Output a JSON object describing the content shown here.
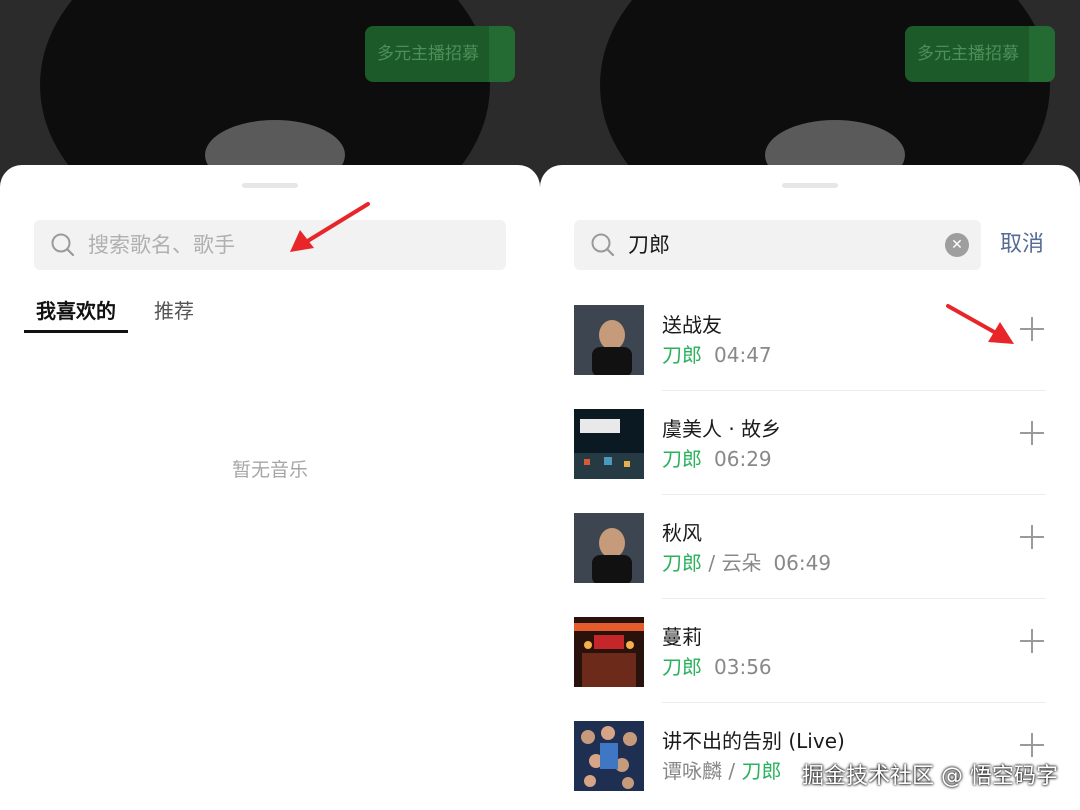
{
  "background": {
    "badge_text": "多元主播招募"
  },
  "left_panel": {
    "search_placeholder": "搜索歌名、歌手",
    "tabs": [
      "我喜欢的",
      "推荐"
    ],
    "empty_text": "暂无音乐"
  },
  "right_panel": {
    "search_query": "刀郎",
    "cancel_label": "取消",
    "songs": [
      {
        "title": "送战友",
        "artist": "刀郎",
        "second_artist": "",
        "duration": "04:47",
        "cover": "portrait"
      },
      {
        "title": "虞美人 · 故乡",
        "artist": "刀郎",
        "second_artist": "",
        "duration": "06:29",
        "cover": "night-street"
      },
      {
        "title": "秋风",
        "artist": "刀郎",
        "second_artist": "云朵",
        "duration": "06:49",
        "cover": "portrait"
      },
      {
        "title": "蔓莉",
        "artist": "刀郎",
        "second_artist": "",
        "duration": "03:56",
        "cover": "market-gate"
      },
      {
        "title": "讲不出的告别 (Live)",
        "artist": "谭咏麟",
        "second_artist": "刀郎",
        "duration": "",
        "cover": "concert-poster"
      }
    ]
  },
  "watermark": "掘金技术社区 @ 悟空码字",
  "colors": {
    "accent_green": "#2bb25d",
    "cancel_blue": "#576b95",
    "annotation_red": "#e8262a"
  }
}
